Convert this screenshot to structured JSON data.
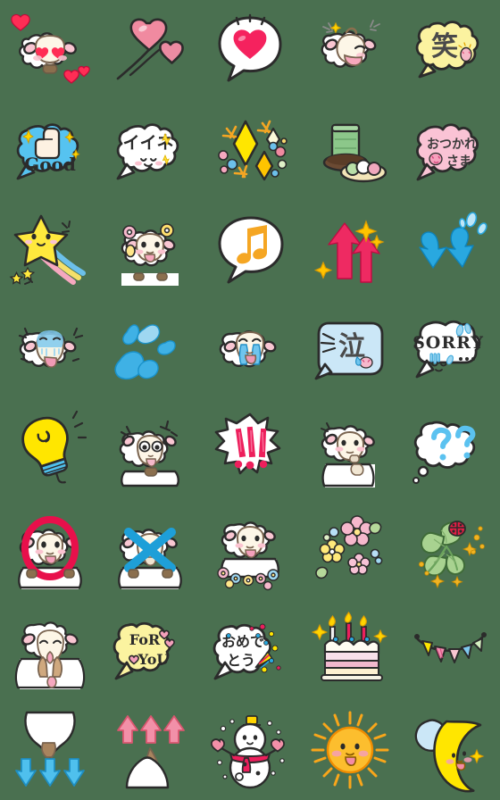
{
  "page": {
    "title": "Sheep Emoji Sticker Sheet",
    "background_color": "#4a7050",
    "grid": {
      "columns": 5,
      "rows": 8,
      "cell_size_px": 112,
      "total_items": 40
    }
  },
  "palette": {
    "outline": "#2b2b2b",
    "sheep_wool": "#ffffff",
    "sheep_face": "#fdf6e7",
    "ear_pink": "#f9c6d2",
    "heart_red": "#ff2d55",
    "heart_pink": "#f08aa0",
    "bubble_yellow": "#fbf3a0",
    "bubble_blue": "#56c3f0",
    "bubble_lightblue": "#cbe7f7",
    "bubble_pink": "#fac3d5",
    "bubble_white": "#ffffff",
    "arrow_pink": "#ee2a62",
    "arrow_blue": "#29a8e0",
    "star_yellow": "#ffe93d",
    "music_orange": "#f5a623",
    "clover_green": "#9cc88a",
    "tea_green": "#8cc78a",
    "sun_orange": "#f9a61a",
    "moon_yellow": "#ffe600",
    "question_blue": "#5bc2f0",
    "circle_red": "#e8104b",
    "cross_blue": "#1e9fd8"
  },
  "items": [
    {
      "row": 1,
      "col": 1,
      "name": "sheep-in-love",
      "label": "Sheep with heart eyes",
      "text": ""
    },
    {
      "row": 1,
      "col": 2,
      "name": "flying-hearts",
      "label": "Two flying pink hearts",
      "text": ""
    },
    {
      "row": 1,
      "col": 3,
      "name": "heart-speech-bubble",
      "label": "White bubble with red heart",
      "text": ""
    },
    {
      "row": 1,
      "col": 4,
      "name": "sheep-laughing",
      "label": "Laughing sheep with sparkles",
      "text": ""
    },
    {
      "row": 1,
      "col": 5,
      "name": "laugh-bubble",
      "label": "Yellow bubble, kanji laugh",
      "text": "笑"
    },
    {
      "row": 2,
      "col": 1,
      "name": "good-bubble",
      "label": "Blue cloud bubble thumbs up",
      "text": "Good"
    },
    {
      "row": 2,
      "col": 2,
      "name": "iine-bubble",
      "label": "White bubble nice",
      "text": "イイネ"
    },
    {
      "row": 2,
      "col": 3,
      "name": "sparkle-diamonds",
      "label": "Yellow sparkling diamonds",
      "text": ""
    },
    {
      "row": 2,
      "col": 4,
      "name": "green-tea-dango",
      "label": "Green tea cup with sweets",
      "text": ""
    },
    {
      "row": 2,
      "col": 5,
      "name": "otsukaresama-bubble",
      "label": "Pink bubble good work",
      "text": "おつかれ さま"
    },
    {
      "row": 3,
      "col": 1,
      "name": "shooting-star",
      "label": "Smiling star with rainbow trail",
      "text": ""
    },
    {
      "row": 3,
      "col": 2,
      "name": "sheep-with-flowers",
      "label": "Happy sheep with flower ears",
      "text": ""
    },
    {
      "row": 3,
      "col": 3,
      "name": "music-note-bubble",
      "label": "White bubble with music note",
      "text": ""
    },
    {
      "row": 3,
      "col": 4,
      "name": "up-arrows-pink",
      "label": "Two pink up arrows sparkle",
      "text": ""
    },
    {
      "row": 3,
      "col": 5,
      "name": "down-arrows-blue",
      "label": "Two blue down arrows splash",
      "text": ""
    },
    {
      "row": 4,
      "col": 1,
      "name": "sheep-shocked",
      "label": "Shocked pale sheep",
      "text": ""
    },
    {
      "row": 4,
      "col": 2,
      "name": "water-splash",
      "label": "Blue water splash droplets",
      "text": ""
    },
    {
      "row": 4,
      "col": 3,
      "name": "sheep-crying",
      "label": "Crying sheep with tears",
      "text": ""
    },
    {
      "row": 4,
      "col": 4,
      "name": "cry-bubble",
      "label": "Light blue bubble kanji cry",
      "text": "泣"
    },
    {
      "row": 4,
      "col": 5,
      "name": "sorry-bubble",
      "label": "White bubble sorry crying face",
      "text": "SORRY"
    },
    {
      "row": 5,
      "col": 1,
      "name": "lightbulb-idea",
      "label": "Yellow lightbulb idea",
      "text": ""
    },
    {
      "row": 5,
      "col": 2,
      "name": "sheep-surprised",
      "label": "Surprised sheep wide eyes",
      "text": ""
    },
    {
      "row": 5,
      "col": 3,
      "name": "exclamation-marks",
      "label": "Three pink exclamation marks",
      "text": "!!!"
    },
    {
      "row": 5,
      "col": 4,
      "name": "sheep-thinking",
      "label": "Thinking sheep hand on chin",
      "text": ""
    },
    {
      "row": 5,
      "col": 5,
      "name": "question-bubble",
      "label": "White thought cloud question marks",
      "text": "??"
    },
    {
      "row": 6,
      "col": 1,
      "name": "sheep-circle-ok",
      "label": "Sheep inside red circle OK",
      "text": ""
    },
    {
      "row": 6,
      "col": 2,
      "name": "sheep-cross-no",
      "label": "Sheep with blue cross NG",
      "text": ""
    },
    {
      "row": 6,
      "col": 3,
      "name": "sheep-flower-field",
      "label": "Sheep in flower field",
      "text": ""
    },
    {
      "row": 6,
      "col": 4,
      "name": "flowers",
      "label": "Scattered pastel flowers",
      "text": ""
    },
    {
      "row": 6,
      "col": 5,
      "name": "four-leaf-clover",
      "label": "Four leaf clover with ladybug",
      "text": ""
    },
    {
      "row": 7,
      "col": 1,
      "name": "sheep-praying",
      "label": "Praying sheep hands together",
      "text": ""
    },
    {
      "row": 7,
      "col": 2,
      "name": "for-you-bubble",
      "label": "Yellow bubble for you hearts",
      "text": "FoR YoU"
    },
    {
      "row": 7,
      "col": 3,
      "name": "omedetou-bubble",
      "label": "White bubble congratulations confetti",
      "text": "おめで とう"
    },
    {
      "row": 7,
      "col": 4,
      "name": "birthday-cake",
      "label": "Birthday cake with candles",
      "text": ""
    },
    {
      "row": 7,
      "col": 5,
      "name": "party-bunting",
      "label": "Colourful bunting flags",
      "text": ""
    },
    {
      "row": 8,
      "col": 1,
      "name": "sheep-down-arrows",
      "label": "Sheep down with blue arrows",
      "text": ""
    },
    {
      "row": 8,
      "col": 2,
      "name": "sheep-up-arrows",
      "label": "Sheep up with pink arrows",
      "text": ""
    },
    {
      "row": 8,
      "col": 3,
      "name": "snowman",
      "label": "Snowman with scarf and mittens",
      "text": ""
    },
    {
      "row": 8,
      "col": 4,
      "name": "smiling-sun",
      "label": "Smiling orange sun",
      "text": ""
    },
    {
      "row": 8,
      "col": 5,
      "name": "crescent-moon",
      "label": "Yellow crescent moon with cloud",
      "text": ""
    }
  ]
}
